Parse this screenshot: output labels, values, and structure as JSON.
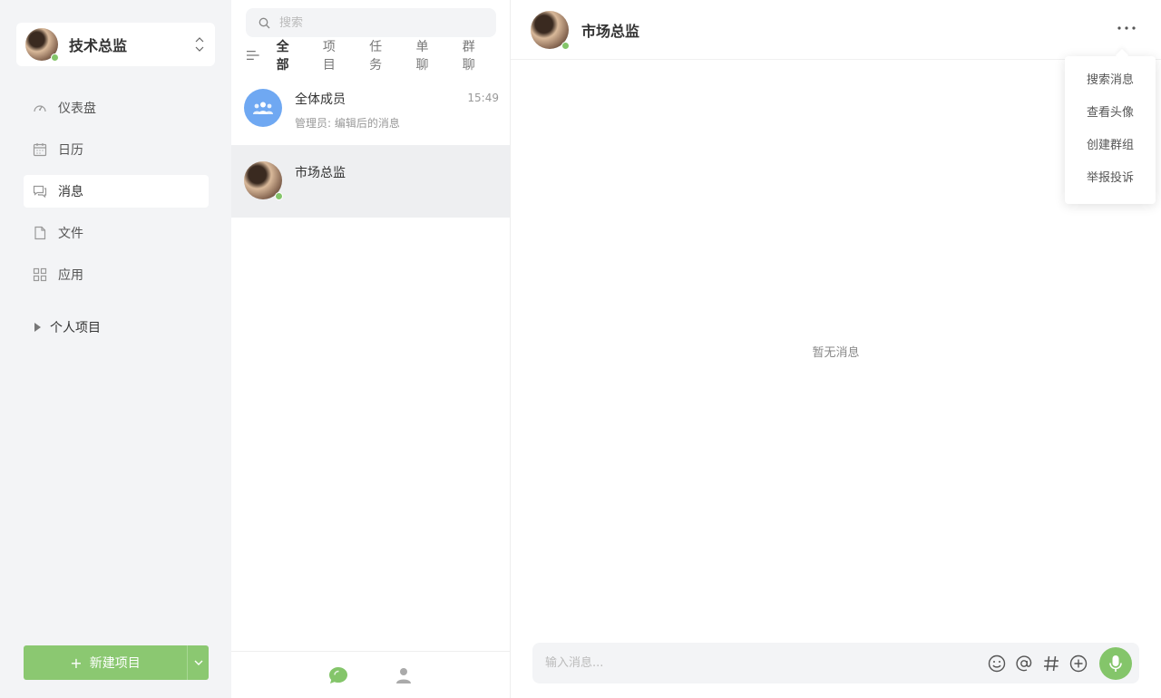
{
  "account": {
    "name": "技术总监",
    "status": "online"
  },
  "sidebar": {
    "items": [
      {
        "label": "仪表盘",
        "icon": "dashboard-icon"
      },
      {
        "label": "日历",
        "icon": "calendar-icon"
      },
      {
        "label": "消息",
        "icon": "message-icon",
        "active": true
      },
      {
        "label": "文件",
        "icon": "file-icon"
      },
      {
        "label": "应用",
        "icon": "apps-icon"
      }
    ],
    "project_group": "个人项目",
    "new_project": "新建项目"
  },
  "list": {
    "search_placeholder": "搜索",
    "tabs": [
      "全部",
      "项目",
      "任务",
      "单聊",
      "群聊"
    ],
    "active_tab": "全部",
    "conversations": [
      {
        "title": "全体成员",
        "preview": "管理员: 编辑后的消息",
        "time": "15:49",
        "type": "group"
      },
      {
        "title": "市场总监",
        "preview": "",
        "time": "",
        "type": "user",
        "active": true
      }
    ]
  },
  "chat": {
    "title": "市场总监",
    "empty_text": "暂无消息",
    "input_placeholder": "输入消息..."
  },
  "menu": {
    "items": [
      "搜索消息",
      "查看头像",
      "创建群组",
      "举报投诉"
    ]
  },
  "colors": {
    "accent": "#84c56a",
    "group_avatar": "#6fa8f2"
  }
}
